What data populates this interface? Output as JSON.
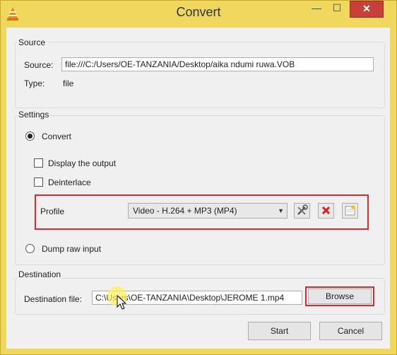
{
  "window": {
    "title": "Convert",
    "min_glyph": "—",
    "max_glyph": "☐",
    "close_glyph": "✕"
  },
  "source": {
    "group_label": "Source",
    "source_label": "Source:",
    "source_value": "file:///C:/Users/OE-TANZANIA/Desktop/aika ndumi ruwa.VOB",
    "type_label": "Type:",
    "type_value": "file"
  },
  "settings": {
    "group_label": "Settings",
    "convert_label": "Convert",
    "display_output_label": "Display the output",
    "deinterlace_label": "Deinterlace",
    "profile_label": "Profile",
    "profile_value": "Video - H.264 + MP3 (MP4)",
    "dump_raw_label": "Dump raw input"
  },
  "destination": {
    "group_label": "Destination",
    "file_label": "Destination file:",
    "file_value": "C:\\Users\\OE-TANZANIA\\Desktop\\JEROME 1.mp4",
    "browse_label": "Browse"
  },
  "actions": {
    "start_label": "Start",
    "cancel_label": "Cancel"
  },
  "colors": {
    "title_bar": "#f0d75e",
    "close_red": "#c7403a",
    "highlight_red": "#e0282c"
  },
  "icons": [
    "vlc-cone-icon",
    "wrench-icon",
    "delete-profile-icon",
    "new-profile-icon",
    "mouse-cursor-icon"
  ]
}
